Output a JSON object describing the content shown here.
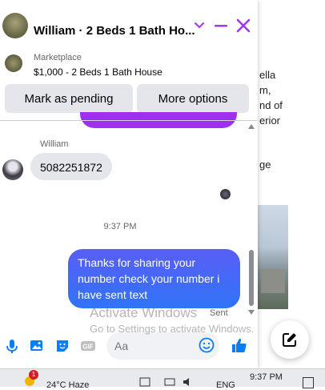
{
  "header": {
    "title": "William · 2 Beds 1 Bath Ho...",
    "accent": "#a034f0"
  },
  "marketplace": {
    "label": "Marketplace",
    "title": "$1,000 - 2 Beds 1 Bath House"
  },
  "actions": {
    "mark_pending": "Mark as pending",
    "more_options": "More options"
  },
  "messages": {
    "sender_name": "William",
    "them_text": "5082251872",
    "timestamp": "9:37 PM",
    "me_text": "Thanks for sharing your number check your number i have sent text",
    "status": "Sent"
  },
  "composer": {
    "placeholder": "Aa"
  },
  "background": {
    "lines": [
      "ella",
      "m,",
      "nd of",
      "erior",
      "",
      "ge"
    ]
  },
  "watermark": {
    "line1": "Activate Windows",
    "line2": "Go to Settings to activate Windows."
  },
  "taskbar": {
    "notification_count": "1",
    "weather": "24°C  Haze",
    "language": "ENG",
    "clock": "9:37 PM"
  },
  "colors": {
    "bubble_me": "#3274f6",
    "bubble_them": "#e4e6eb",
    "like_blue": "#0a7cff"
  }
}
